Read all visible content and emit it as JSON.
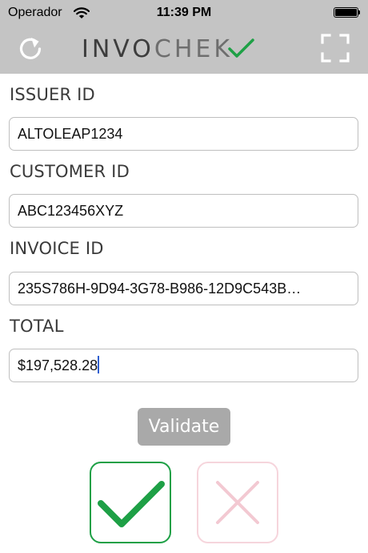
{
  "status_bar": {
    "carrier": "Operador",
    "time": "11:39 PM",
    "icons": [
      "wifi-icon",
      "battery-icon"
    ]
  },
  "header": {
    "logo_text_dark": "INVO",
    "logo_text_light": "CHEK",
    "logo_check_color": "#1ea046",
    "left_icon": "refresh-icon",
    "right_icon": "expand-icon"
  },
  "form": {
    "issuer": {
      "label": "ISSUER ID",
      "value": "ALTOLEAP1234"
    },
    "customer": {
      "label": "CUSTOMER ID",
      "value": "ABC123456XYZ"
    },
    "invoice": {
      "label": "INVOICE ID",
      "value": "235S786H-9D94-3G78-B986-12D9C543B…"
    },
    "total": {
      "label": "TOTAL",
      "value": "$197,528.28"
    }
  },
  "actions": {
    "validate_label": "Validate",
    "valid_icon": "checkmark-icon",
    "invalid_icon": "x-mark-icon",
    "valid_color": "#1ea046",
    "invalid_color": "#f6d5dc"
  }
}
